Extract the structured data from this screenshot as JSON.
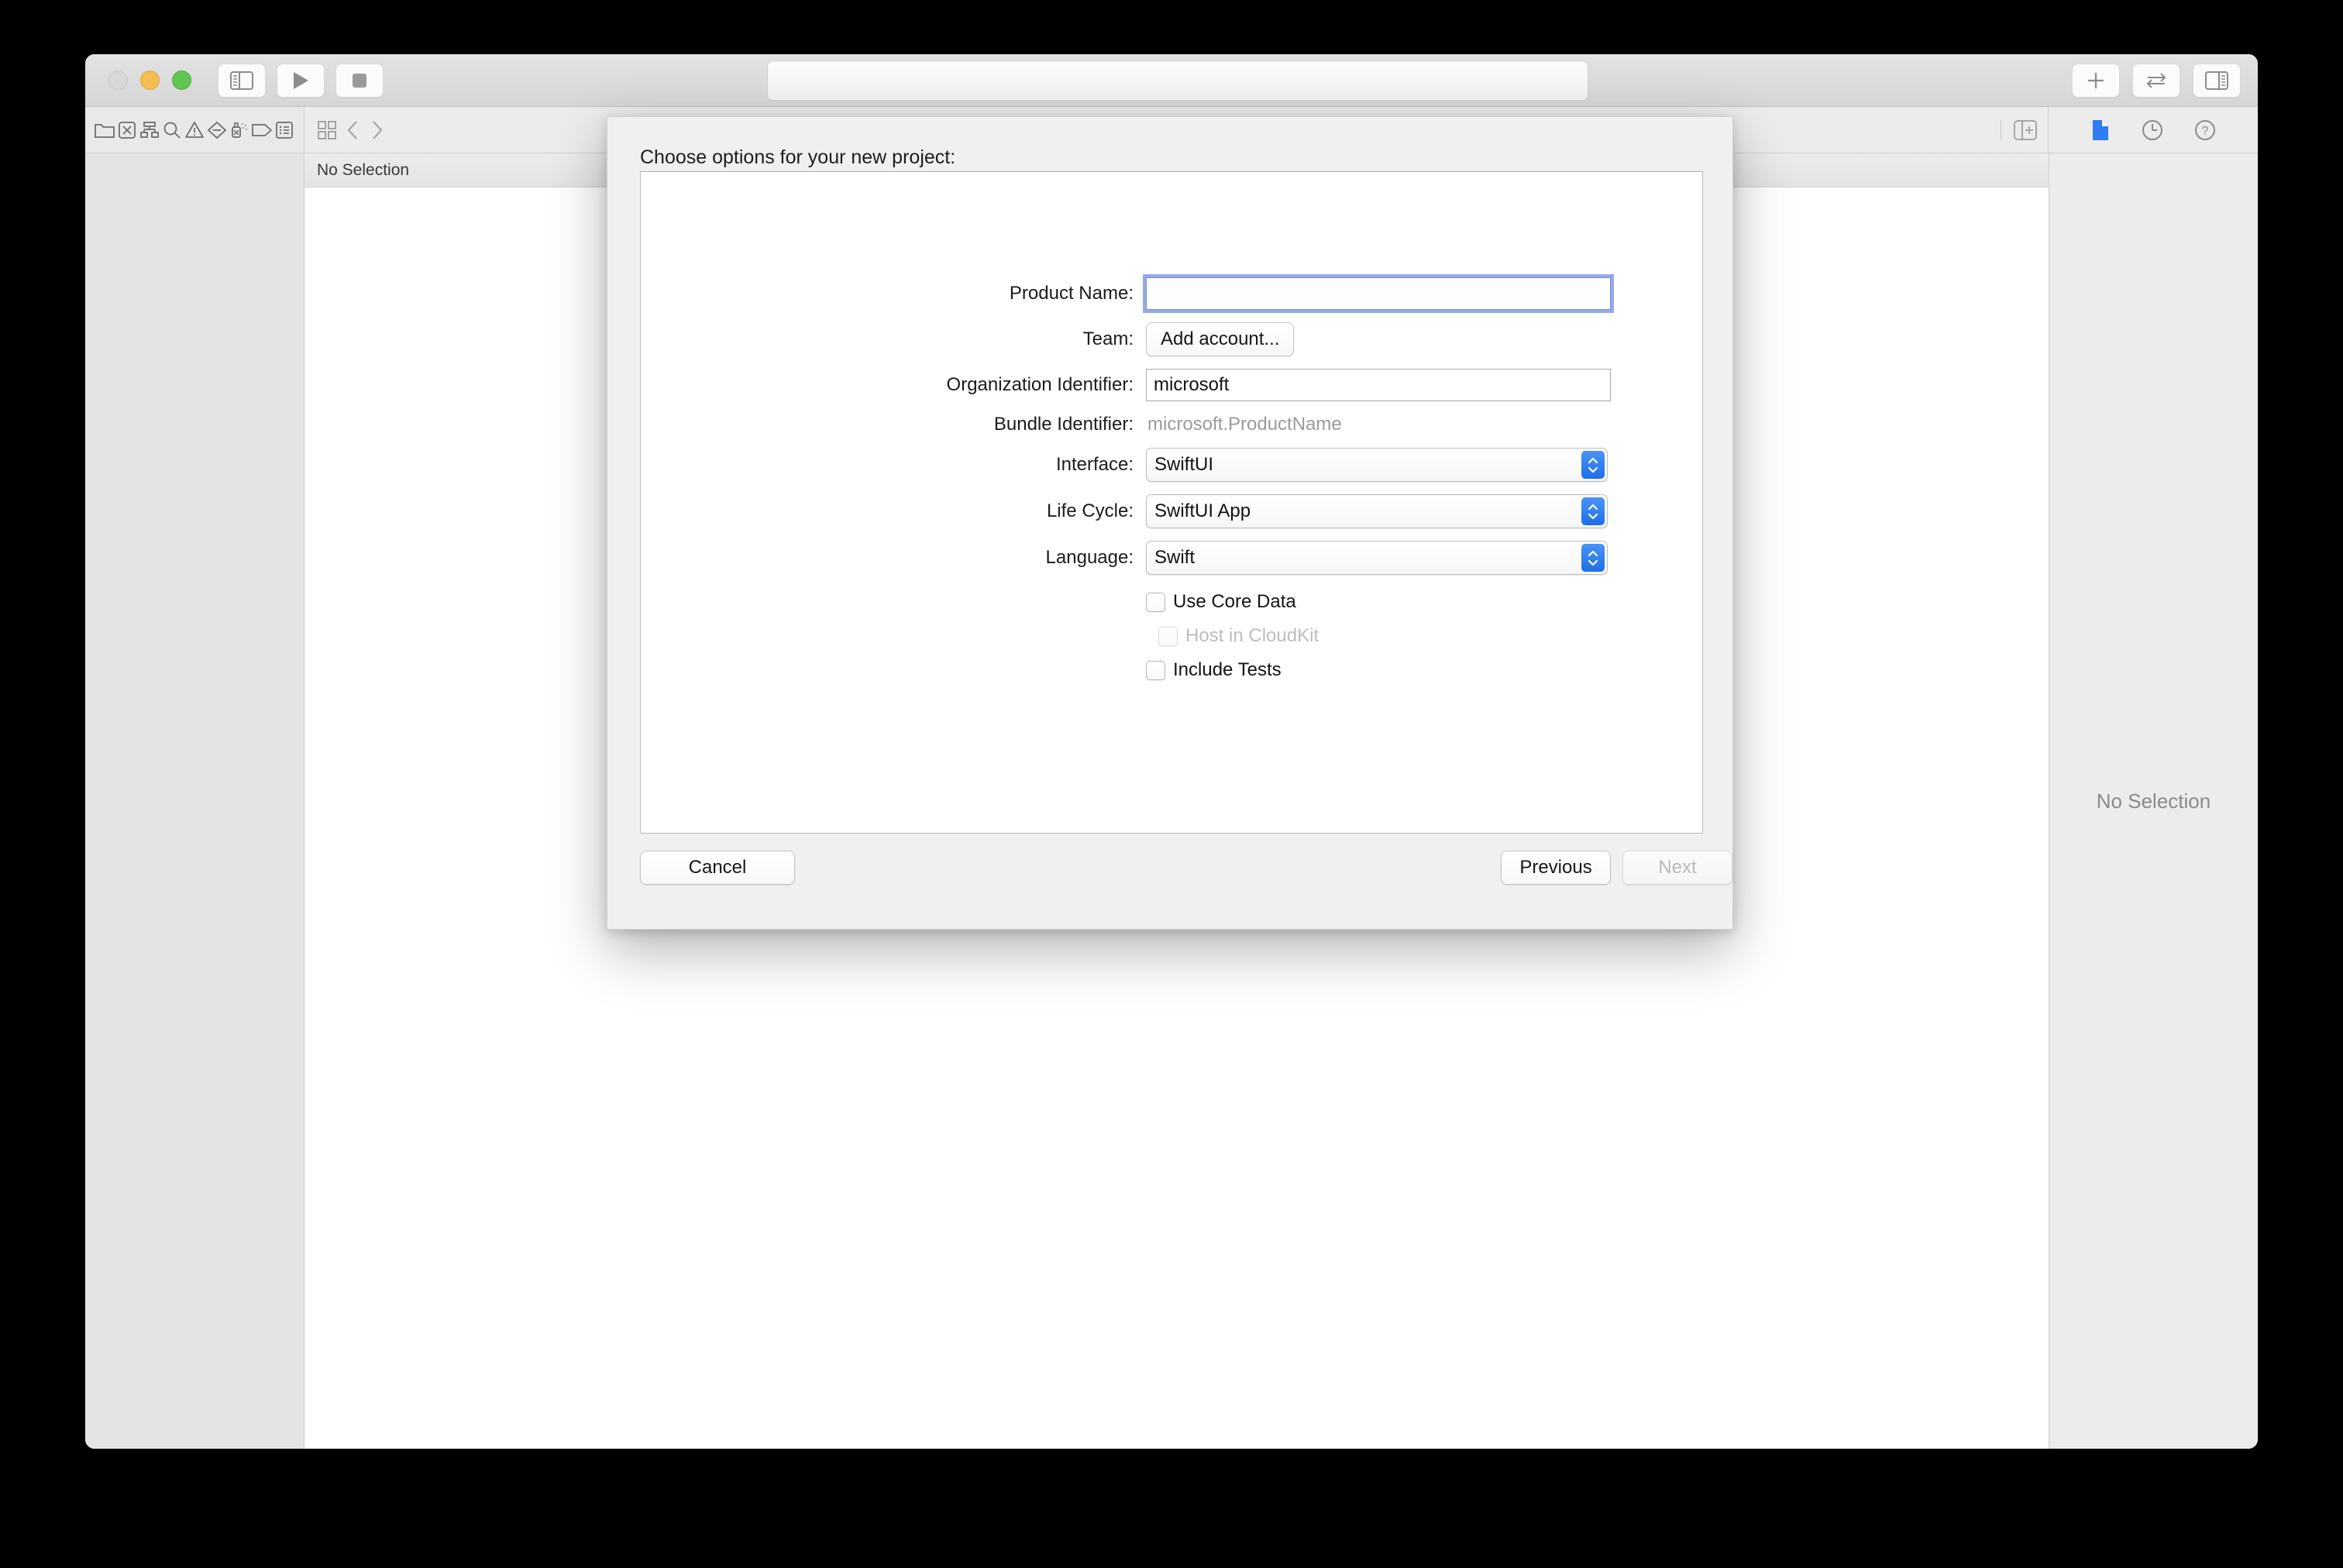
{
  "window": {
    "traffic_lights": [
      "close",
      "minimize",
      "zoom"
    ],
    "toolbar_left": [
      "sidebar-toggle-icon",
      "run-icon",
      "stop-icon"
    ],
    "toolbar_right": [
      "add-icon",
      "swap-arrows-icon",
      "inspector-toggle-icon"
    ],
    "navigator_icons": [
      "folder-icon",
      "source-control-icon",
      "symbol-hierarchy-icon",
      "search-icon",
      "warning-icon",
      "breakpoint-icon",
      "test-spray-icon",
      "tag-icon",
      "report-icon"
    ],
    "editor_icons": [
      "grid-icon",
      "back-chevron-icon",
      "forward-chevron-icon"
    ],
    "editor_right_icons": [
      "add-editor-icon"
    ],
    "inspector_icons": [
      "file-inspector-icon",
      "history-inspector-icon",
      "help-inspector-icon"
    ],
    "jump_bar_text": "No Selection",
    "inspector_empty_text": "No Selection",
    "accent_color": "#2f7cf6"
  },
  "sheet": {
    "title": "Choose options for your new project:",
    "fields": {
      "product_name": {
        "label": "Product Name:",
        "value": "",
        "placeholder": "",
        "focused": true
      },
      "team": {
        "label": "Team:",
        "button_label": "Add account..."
      },
      "organization_identifier": {
        "label": "Organization Identifier:",
        "value": "microsoft"
      },
      "bundle_identifier": {
        "label": "Bundle Identifier:",
        "value": "microsoft.ProductName"
      },
      "interface": {
        "label": "Interface:",
        "value": "SwiftUI"
      },
      "life_cycle": {
        "label": "Life Cycle:",
        "value": "SwiftUI App"
      },
      "language": {
        "label": "Language:",
        "value": "Swift"
      }
    },
    "checkboxes": [
      {
        "label": "Use Core Data",
        "checked": false,
        "disabled": false
      },
      {
        "label": "Host in CloudKit",
        "checked": false,
        "disabled": true
      },
      {
        "label": "Include Tests",
        "checked": false,
        "disabled": false
      }
    ],
    "buttons": {
      "cancel": "Cancel",
      "previous": "Previous",
      "next": "Next",
      "next_disabled": true
    },
    "focus_ring_color": "#93a9ee"
  }
}
